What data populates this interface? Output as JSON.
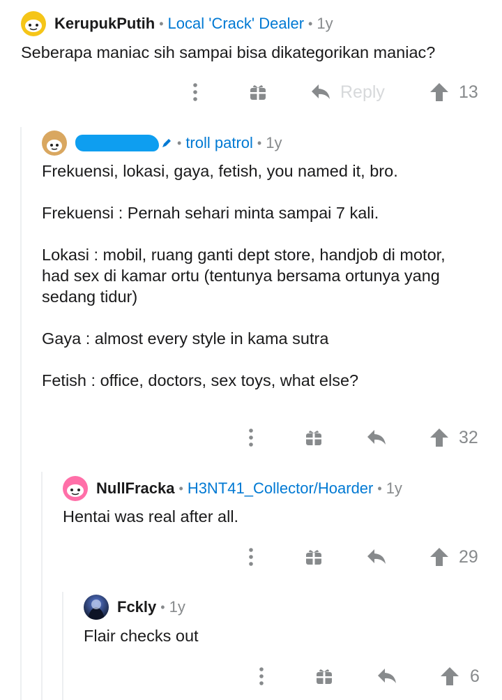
{
  "comments": [
    {
      "username": "KerupukPutih",
      "flair": "Local 'Crack' Dealer",
      "age": "1y",
      "body": "Seberapa maniac sih sampai bisa dikategorikan maniac?",
      "reply_label": "Reply",
      "votes": "13",
      "avatar_color": "#f5c518"
    },
    {
      "username": "",
      "flair": "troll patrol",
      "age": "1y",
      "body": "Frekuensi, lokasi, gaya, fetish, you named it, bro.\n\nFrekuensi : Pernah sehari minta sampai 7 kali.\n\nLokasi : mobil, ruang ganti dept store, handjob di motor,\nhad sex di kamar ortu (tentunya bersama ortunya yang\nsedang tidur)\n\nGaya : almost every style in kama sutra\n\nFetish : office, doctors, sex toys, what else?",
      "votes": "32",
      "avatar_color": "#d9a760"
    },
    {
      "username": "NullFracka",
      "flair": "H3NT41_Collector/Hoarder",
      "age": "1y",
      "body": "Hentai was real after all.",
      "votes": "29",
      "avatar_color": "#ff6fa8"
    },
    {
      "username": "Fckly",
      "age": "1y",
      "body": "Flair checks out",
      "votes": "6",
      "avatar_color": "#1c2a4a"
    }
  ],
  "colors": {
    "accent": "#0079d3",
    "meta": "#878a8c",
    "icon": "#878a8c",
    "thread": "#edeff1"
  }
}
